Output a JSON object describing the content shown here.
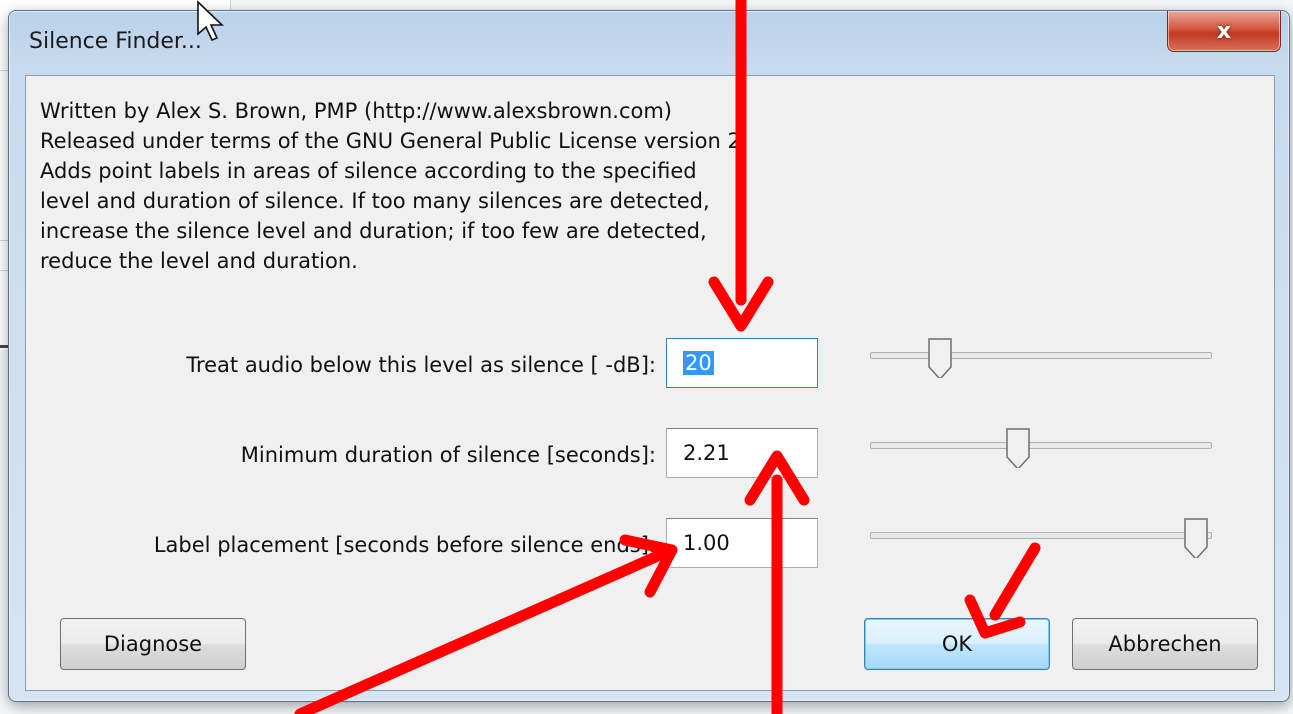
{
  "dialog": {
    "title": "Silence Finder...",
    "close_label": "x"
  },
  "description": "Written by Alex S. Brown, PMP (http://www.alexsbrown.com)\nReleased under terms of the GNU General Public License version 2\nAdds point labels in areas of silence according to the specified\nlevel and duration of silence. If too many silences are detected,\nincrease the silence level and duration; if too few are detected,\nreduce the level and duration.",
  "fields": [
    {
      "label": "Treat audio below this level as silence [ -dB]:",
      "value": "20",
      "slider_position": 0.2
    },
    {
      "label": "Minimum duration of silence [seconds]:",
      "value": "2.21",
      "slider_position": 0.44
    },
    {
      "label": "Label placement [seconds before silence ends]:",
      "value": "1.00",
      "slider_position": 0.95
    }
  ],
  "buttons": {
    "diagnose": "Diagnose",
    "ok": "OK",
    "cancel": "Abbrechen"
  },
  "colors": {
    "annotation_arrow": "#ff0000",
    "selection": "#3399ff",
    "close_button": "#c94a32"
  }
}
